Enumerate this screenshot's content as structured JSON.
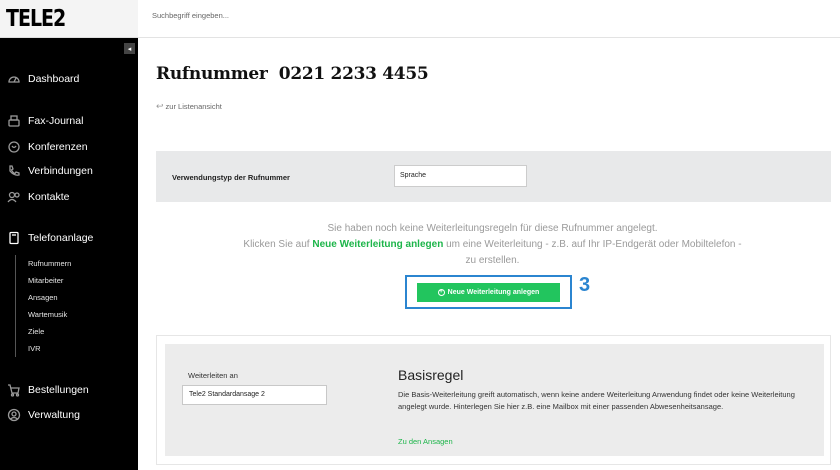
{
  "brand": {
    "logo_text": "TELE2"
  },
  "search": {
    "placeholder": "Suchbegriff eingeben..."
  },
  "sidebar": {
    "collapse_icon": "◂",
    "items": [
      {
        "label": "Dashboard",
        "icon": "dashboard-icon"
      },
      {
        "label": "Fax-Journal",
        "icon": "fax-icon"
      },
      {
        "label": "Konferenzen",
        "icon": "conference-icon"
      },
      {
        "label": "Verbindungen",
        "icon": "phone-icon"
      },
      {
        "label": "Kontakte",
        "icon": "contacts-icon"
      },
      {
        "label": "Telefonanlage",
        "icon": "phone-system-icon"
      },
      {
        "label": "Bestellungen",
        "icon": "cart-icon"
      },
      {
        "label": "Verwaltung",
        "icon": "admin-icon"
      }
    ],
    "subitems": [
      "Rufnummern",
      "Mitarbeiter",
      "Ansagen",
      "Wartemusik",
      "Ziele",
      "IVR"
    ]
  },
  "page": {
    "title": "Rufnummer  0221 2233 4455",
    "back_link": "zur Listenansicht"
  },
  "usage": {
    "label": "Verwendungstyp der Rufnummer",
    "value": "Sprache"
  },
  "info": {
    "line1": "Sie haben noch keine Weiterleitungsregeln für diese Rufnummer angelegt.",
    "line2_prefix": "Klicken Sie auf ",
    "line2_highlight": "Neue Weiterleitung anlegen",
    "line2_suffix": " um eine Weiterleitung - z.B. auf Ihr IP-Endgerät oder Mobiltelefon - zu erstellen."
  },
  "new_button": {
    "label": "Neue Weiterleitung anlegen",
    "step": "3"
  },
  "rule": {
    "forward_label": "Weiterleiten an",
    "forward_value": "Tele2 Standardansage 2",
    "title": "Basisregel",
    "description": "Die Basis-Weiterleitung greift automatisch, wenn keine andere Weiterleitung Anwendung findet oder keine Weiterleitung angelegt wurde. Hinterlegen Sie hier z.B. eine Mailbox mit einer passenden Abwesenheitsansage.",
    "link": "Zu den Ansagen"
  },
  "colors": {
    "accent_green": "#22c55e",
    "highlight_blue": "#2b85d0",
    "sidebar_bg": "#000000"
  }
}
